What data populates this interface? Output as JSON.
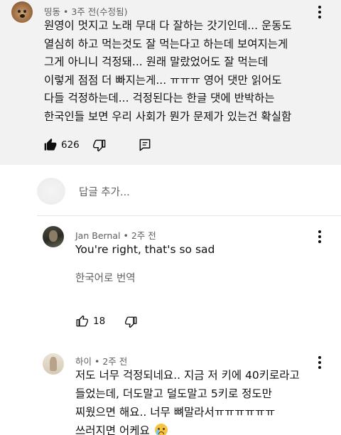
{
  "top_comment": {
    "author": "띵동",
    "time": "3주 전(수정됨)",
    "lines": [
      "원영이 멋지고 노래 무대 다 잘하는 갓기인데... 운동도",
      "열심히 하고 먹는것도 잘 먹는다고 하는데 보여지는게",
      "그게 아니니 걱정돼... 원래 말랐었어도 잘 먹는데",
      "이렇게 점점 더 빠지는게... ㅠㅠㅠ 영어 댓만 읽어도",
      "다들 걱정하는데... 걱정된다는 한글 댓에 반박하는",
      "한국인들 보면 우리 사회가 뭔가 문제가 있는건 확실함"
    ],
    "likes": "626",
    "icons": {
      "like": "thumbs-up-filled-icon",
      "dislike": "thumbs-down-icon",
      "reply": "comment-icon",
      "menu": "more-vert-icon"
    }
  },
  "reply_box": {
    "placeholder": "답글 추가..."
  },
  "replies": [
    {
      "author": "Jan Bernal",
      "time": "2주 전",
      "text": "You're right, that's so sad",
      "translate": "한국어로 번역",
      "likes": "18"
    },
    {
      "author": "하이",
      "time": "2주 전",
      "lines": [
        "저도 너무 걱정되네요.. 지금 저 키에 40키로라고",
        "들었는데, 더도말고 덜도말고 5키로 정도만",
        "찌웠으면 해요.. 너무 뼈말라서ㅠㅠㅠㅠㅠㅠ",
        "쓰러지면 어케요"
      ],
      "emoji": "crying-face-emoji"
    }
  ]
}
